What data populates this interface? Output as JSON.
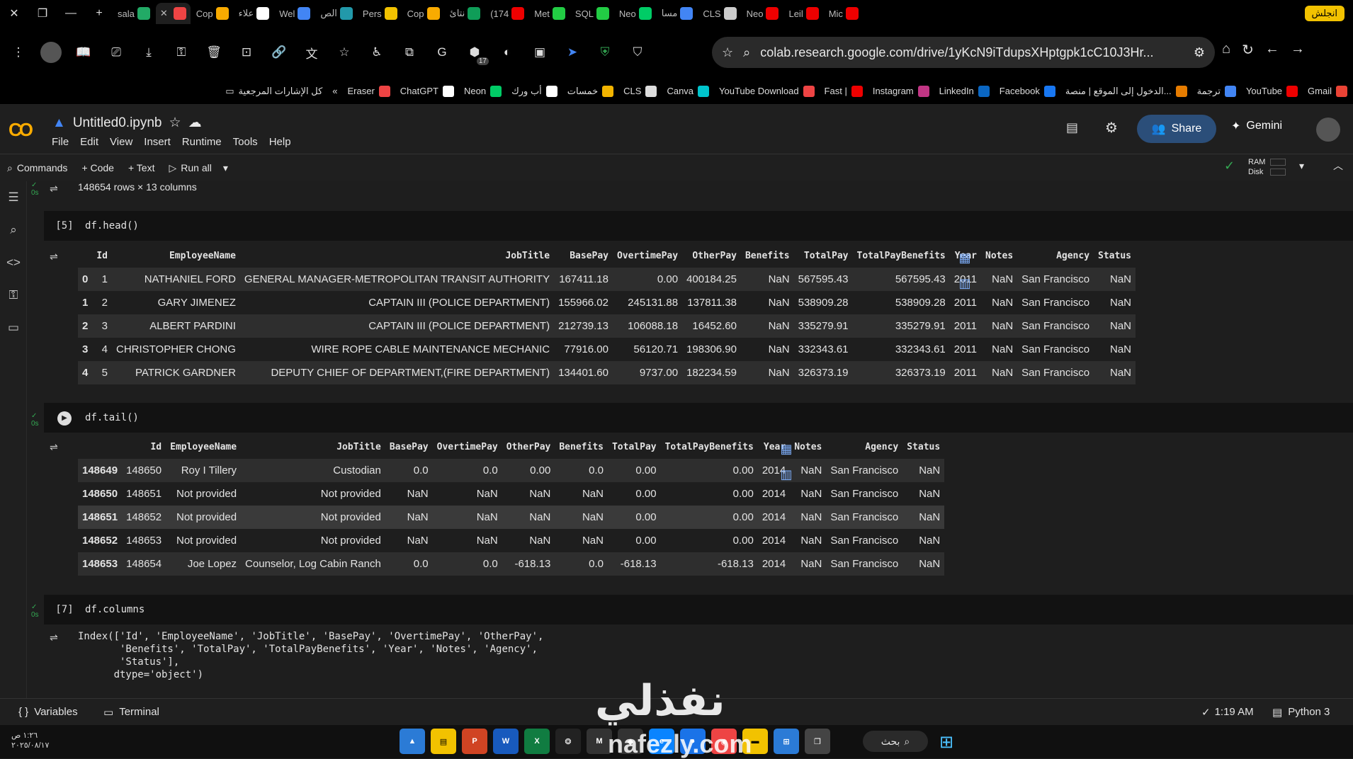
{
  "browser": {
    "tabs": [
      {
        "label": "sala",
        "color": "#2a6"
      },
      {
        "label": "",
        "color": "#e44",
        "close": "✕",
        "active": true
      },
      {
        "label": "Cop",
        "color": "#f9ab00"
      },
      {
        "label": "علاء",
        "color": "#fff"
      },
      {
        "label": "Wel",
        "color": "#4285f4"
      },
      {
        "label": "الص",
        "color": "#29a"
      },
      {
        "label": "Pers",
        "color": "#f2c200"
      },
      {
        "label": "Cop",
        "color": "#f9ab00"
      },
      {
        "label": "نتائ",
        "color": "#0f9d58"
      },
      {
        "label": "(174",
        "color": "#e00"
      },
      {
        "label": "Met",
        "color": "#2c4"
      },
      {
        "label": "SQL",
        "color": "#2c4"
      },
      {
        "label": "Neo",
        "color": "#0c6"
      },
      {
        "label": "مسا",
        "color": "#4285f4"
      },
      {
        "label": "CLS",
        "color": "#ccc"
      },
      {
        "label": "Neo",
        "color": "#e00"
      },
      {
        "label": "Leil",
        "color": "#e00"
      },
      {
        "label": "Mic",
        "color": "#e00"
      }
    ],
    "new_tab": "+",
    "profile_chip": "انجلش",
    "url": "colab.research.google.com/drive/1yKcN9iTdupsXHptgpk1cC10J3Hr...",
    "extension_badge": "17",
    "bookmarks": [
      {
        "label": "Gmail",
        "color": "#ea4335"
      },
      {
        "label": "YouTube",
        "color": "#e00"
      },
      {
        "label": "ترجمة",
        "color": "#4285f4"
      },
      {
        "label": "الدخول إلى الموقع | منصة...",
        "color": "#e67c00"
      },
      {
        "label": "Facebook",
        "color": "#1877f2"
      },
      {
        "label": "LinkedIn",
        "color": "#0a66c2"
      },
      {
        "label": "Instagram",
        "color": "#c13584"
      },
      {
        "label": "Fast |",
        "color": "#e00"
      },
      {
        "label": "YouTube Download",
        "color": "#e44"
      },
      {
        "label": "Canva",
        "color": "#00c4cc"
      },
      {
        "label": "CLS",
        "color": "#ddd"
      },
      {
        "label": "خمسات",
        "color": "#f2b400"
      },
      {
        "label": "أب ورك",
        "color": "#fff"
      },
      {
        "label": "Neon",
        "color": "#0c6"
      },
      {
        "label": "ChatGPT",
        "color": "#fff"
      },
      {
        "label": "Eraser",
        "color": "#e44"
      }
    ],
    "all_bookmarks": "كل الإشارات المرجعية"
  },
  "colab": {
    "logo": "CO",
    "title": "Untitled0.ipynb",
    "menus": [
      "File",
      "Edit",
      "View",
      "Insert",
      "Runtime",
      "Tools",
      "Help"
    ],
    "share": "Share",
    "gemini": "Gemini",
    "toolbar": {
      "commands": "Commands",
      "code": "+ Code",
      "text": "+ Text",
      "run_all": "Run all",
      "ram": "RAM",
      "disk": "Disk"
    },
    "prev_output": "148654 rows × 13 columns"
  },
  "cells": {
    "head": {
      "exec": "[5]",
      "code": "df.head()",
      "time": "0s",
      "columns": [
        "",
        "Id",
        "EmployeeName",
        "JobTitle",
        "BasePay",
        "OvertimePay",
        "OtherPay",
        "Benefits",
        "TotalPay",
        "TotalPayBenefits",
        "Year",
        "Notes",
        "Agency",
        "Status"
      ],
      "rows": [
        [
          "0",
          "1",
          "NATHANIEL FORD",
          "GENERAL MANAGER-METROPOLITAN TRANSIT AUTHORITY",
          "167411.18",
          "0.00",
          "400184.25",
          "NaN",
          "567595.43",
          "567595.43",
          "2011",
          "NaN",
          "San Francisco",
          "NaN"
        ],
        [
          "1",
          "2",
          "GARY JIMENEZ",
          "CAPTAIN III (POLICE DEPARTMENT)",
          "155966.02",
          "245131.88",
          "137811.38",
          "NaN",
          "538909.28",
          "538909.28",
          "2011",
          "NaN",
          "San Francisco",
          "NaN"
        ],
        [
          "2",
          "3",
          "ALBERT PARDINI",
          "CAPTAIN III (POLICE DEPARTMENT)",
          "212739.13",
          "106088.18",
          "16452.60",
          "NaN",
          "335279.91",
          "335279.91",
          "2011",
          "NaN",
          "San Francisco",
          "NaN"
        ],
        [
          "3",
          "4",
          "CHRISTOPHER CHONG",
          "WIRE ROPE CABLE MAINTENANCE MECHANIC",
          "77916.00",
          "56120.71",
          "198306.90",
          "NaN",
          "332343.61",
          "332343.61",
          "2011",
          "NaN",
          "San Francisco",
          "NaN"
        ],
        [
          "4",
          "5",
          "PATRICK GARDNER",
          "DEPUTY CHIEF OF DEPARTMENT,(FIRE DEPARTMENT)",
          "134401.60",
          "9737.00",
          "182234.59",
          "NaN",
          "326373.19",
          "326373.19",
          "2011",
          "NaN",
          "San Francisco",
          "NaN"
        ]
      ]
    },
    "tail": {
      "code": "df.tail()",
      "time": "0s",
      "columns": [
        "",
        "Id",
        "EmployeeName",
        "JobTitle",
        "BasePay",
        "OvertimePay",
        "OtherPay",
        "Benefits",
        "TotalPay",
        "TotalPayBenefits",
        "Year",
        "Notes",
        "Agency",
        "Status"
      ],
      "rows": [
        [
          "148649",
          "148650",
          "Roy I Tillery",
          "Custodian",
          "0.0",
          "0.0",
          "0.00",
          "0.0",
          "0.00",
          "0.00",
          "2014",
          "NaN",
          "San Francisco",
          "NaN"
        ],
        [
          "148650",
          "148651",
          "Not provided",
          "Not provided",
          "NaN",
          "NaN",
          "NaN",
          "NaN",
          "0.00",
          "0.00",
          "2014",
          "NaN",
          "San Francisco",
          "NaN"
        ],
        [
          "148651",
          "148652",
          "Not provided",
          "Not provided",
          "NaN",
          "NaN",
          "NaN",
          "NaN",
          "0.00",
          "0.00",
          "2014",
          "NaN",
          "San Francisco",
          "NaN"
        ],
        [
          "148652",
          "148653",
          "Not provided",
          "Not provided",
          "NaN",
          "NaN",
          "NaN",
          "NaN",
          "0.00",
          "0.00",
          "2014",
          "NaN",
          "San Francisco",
          "NaN"
        ],
        [
          "148653",
          "148654",
          "Joe Lopez",
          "Counselor, Log Cabin Ranch",
          "0.0",
          "0.0",
          "-618.13",
          "0.0",
          "-618.13",
          "-618.13",
          "2014",
          "NaN",
          "San Francisco",
          "NaN"
        ]
      ]
    },
    "columns_cell": {
      "exec": "[7]",
      "code": "df.columns",
      "time": "0s",
      "output": "Index(['Id', 'EmployeeName', 'JobTitle', 'BasePay', 'OvertimePay', 'OtherPay',\n       'Benefits', 'TotalPay', 'TotalPayBenefits', 'Year', 'Notes', 'Agency',\n       'Status'],\n      dtype='object')"
    }
  },
  "status": {
    "variables": "Variables",
    "terminal": "Terminal",
    "time": "1:19 AM",
    "runtime": "Python 3"
  },
  "taskbar": {
    "search": "بحث",
    "clock_time": "١:٢٦ ص",
    "clock_date": "٢٠٢٥/٠٨/١٧"
  },
  "watermark": {
    "arabic": "نفذلي",
    "latin": "nafezly.com"
  }
}
